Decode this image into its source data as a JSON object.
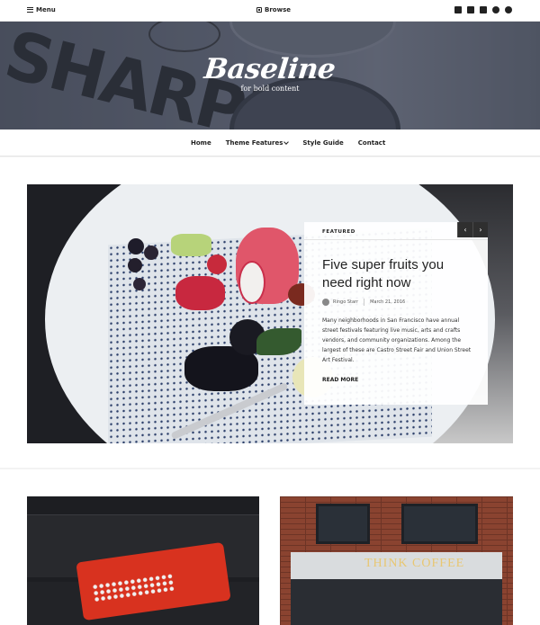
{
  "topbar": {
    "menu_label": "Menu",
    "browse_label": "Browse",
    "social_icons": [
      "twitter-icon",
      "instagram-icon",
      "facebook-icon",
      "pinterest-icon",
      "wordpress-icon"
    ]
  },
  "header": {
    "site_title": "Baseline",
    "tagline": "for bold content"
  },
  "nav": {
    "items": [
      {
        "label": "Home"
      },
      {
        "label": "Theme Features",
        "has_dropdown": true
      },
      {
        "label": "Style Guide"
      },
      {
        "label": "Contact"
      }
    ]
  },
  "featured": {
    "label": "FEATURED",
    "prev_icon": "chevron-left-icon",
    "next_icon": "chevron-right-icon",
    "title": "Five super fruits you need right now",
    "author": "Ringo Starr",
    "date": "March 21, 2016",
    "excerpt": "Many neighborhoods in San Francisco have annual street festivals featuring live music, arts and crafts vendors, and community organizations. Among the largest of these are Castro Street Fair and Union Street Art Festival.",
    "read_more": "READ MORE"
  },
  "posts": {
    "right_sign_text": "THINK COFFEE"
  }
}
